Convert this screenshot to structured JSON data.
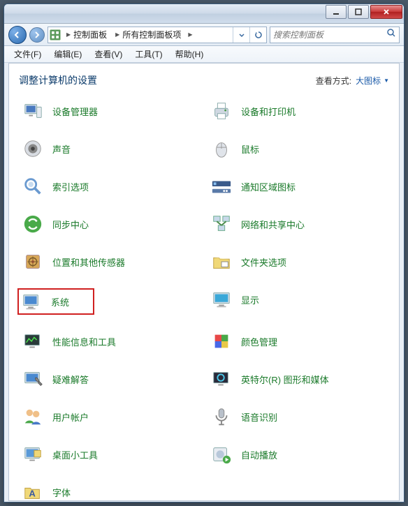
{
  "breadcrumb": {
    "seg1": "控制面板",
    "seg2": "所有控制面板项"
  },
  "search": {
    "placeholder": "搜索控制面板"
  },
  "menu": {
    "file": "文件(F)",
    "edit": "编辑(E)",
    "view": "查看(V)",
    "tools": "工具(T)",
    "help": "帮助(H)"
  },
  "header": {
    "title": "调整计算机的设置",
    "viewby_label": "查看方式:",
    "viewby_mode": "大图标"
  },
  "items": {
    "device_manager": "设备管理器",
    "devices_printers": "设备和打印机",
    "sound": "声音",
    "mouse": "鼠标",
    "indexing": "索引选项",
    "notification_icons": "通知区域图标",
    "sync_center": "同步中心",
    "network_sharing": "网络和共享中心",
    "location_sensors": "位置和其他传感器",
    "folder_options": "文件夹选项",
    "system": "系统",
    "display": "显示",
    "performance": "性能信息和工具",
    "color_mgmt": "颜色管理",
    "troubleshoot": "疑难解答",
    "intel_graphics": "英特尔(R) 图形和媒体",
    "user_accounts": "用户帐户",
    "speech": "语音识别",
    "gadgets": "桌面小工具",
    "autoplay": "自动播放",
    "fonts": "字体"
  }
}
